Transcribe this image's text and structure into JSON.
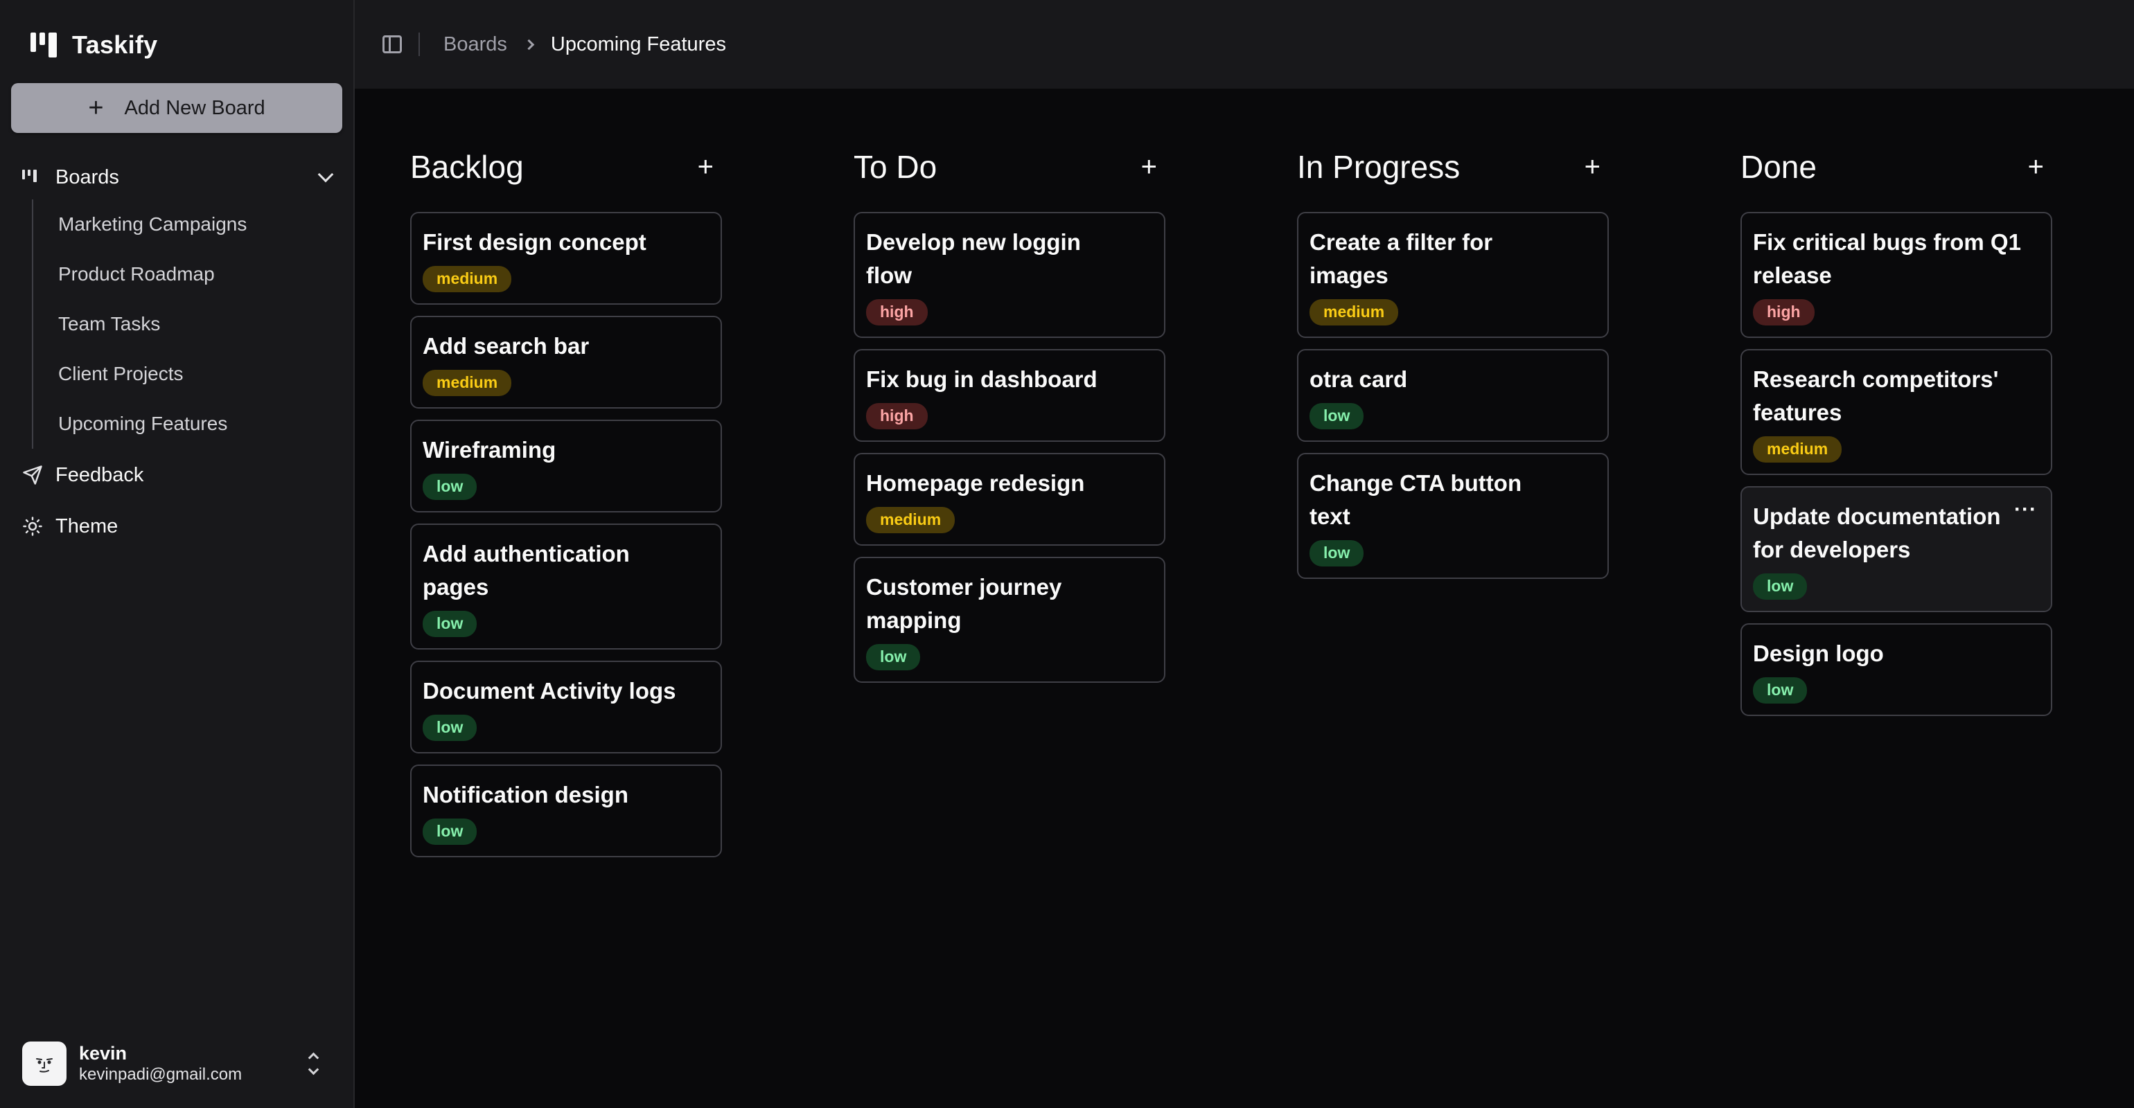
{
  "app": {
    "name": "Taskify"
  },
  "sidebar": {
    "add_board_label": "Add New Board",
    "boards_label": "Boards",
    "boards": [
      "Marketing Campaigns",
      "Product Roadmap",
      "Team Tasks",
      "Client Projects",
      "Upcoming Features"
    ],
    "feedback_label": "Feedback",
    "theme_label": "Theme",
    "user": {
      "name": "kevin",
      "email": "kevinpadi@gmail.com"
    }
  },
  "header": {
    "crumb_root": "Boards",
    "crumb_current": "Upcoming Features"
  },
  "columns": [
    {
      "title": "Backlog",
      "cards": [
        {
          "title": "First design concept",
          "priority": "medium"
        },
        {
          "title": "Add search bar",
          "priority": "medium"
        },
        {
          "title": "Wireframing",
          "priority": "low"
        },
        {
          "title": "Add authentication pages",
          "priority": "low"
        },
        {
          "title": "Document Activity logs",
          "priority": "low"
        },
        {
          "title": "Notification design",
          "priority": "low"
        }
      ]
    },
    {
      "title": "To Do",
      "cards": [
        {
          "title": "Develop new loggin flow",
          "priority": "high"
        },
        {
          "title": "Fix bug in dashboard",
          "priority": "high"
        },
        {
          "title": "Homepage redesign",
          "priority": "medium"
        },
        {
          "title": "Customer journey mapping",
          "priority": "low"
        }
      ]
    },
    {
      "title": "In Progress",
      "cards": [
        {
          "title": "Create a filter for images",
          "priority": "medium"
        },
        {
          "title": "otra card",
          "priority": "low"
        },
        {
          "title": "Change CTA button text",
          "priority": "low"
        }
      ]
    },
    {
      "title": "Done",
      "cards": [
        {
          "title": "Fix critical bugs from Q1 release",
          "priority": "high"
        },
        {
          "title": "Research competitors' features",
          "priority": "medium"
        },
        {
          "title": "Update documentation for developers",
          "priority": "low",
          "menu": "···"
        },
        {
          "title": "Design logo",
          "priority": "low"
        }
      ]
    }
  ],
  "colors": {
    "medium": "#facc15",
    "high": "#fca5a5",
    "low": "#86efac",
    "background": "#09090b",
    "sidebar": "#18181b"
  },
  "icons": {
    "logo": "kanban-logo-icon",
    "add": "plus-icon",
    "boards": "kanban-icon",
    "expand": "chevron-down-icon",
    "feedback": "send-icon",
    "theme": "sun-icon",
    "sidebar_toggle": "panel-left-icon",
    "crumb_separator": "chevron-right-icon",
    "user_menu": "chevrons-up-down-icon",
    "card_menu": "more-horizontal-icon"
  }
}
